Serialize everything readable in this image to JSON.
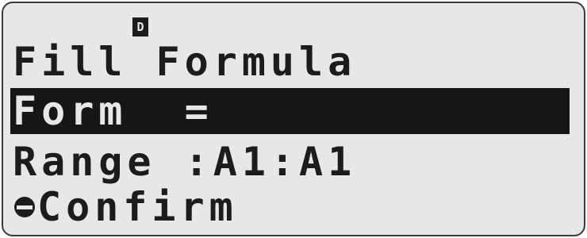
{
  "status_indicator": "D",
  "title": "Fill Formula",
  "form_row": "Form  =",
  "range_row": "Range :A1:A1",
  "confirm_label": "Confirm",
  "colors": {
    "lcd_background": "#e6e8e6",
    "text": "#1c1c1c",
    "highlight": "#161616"
  }
}
